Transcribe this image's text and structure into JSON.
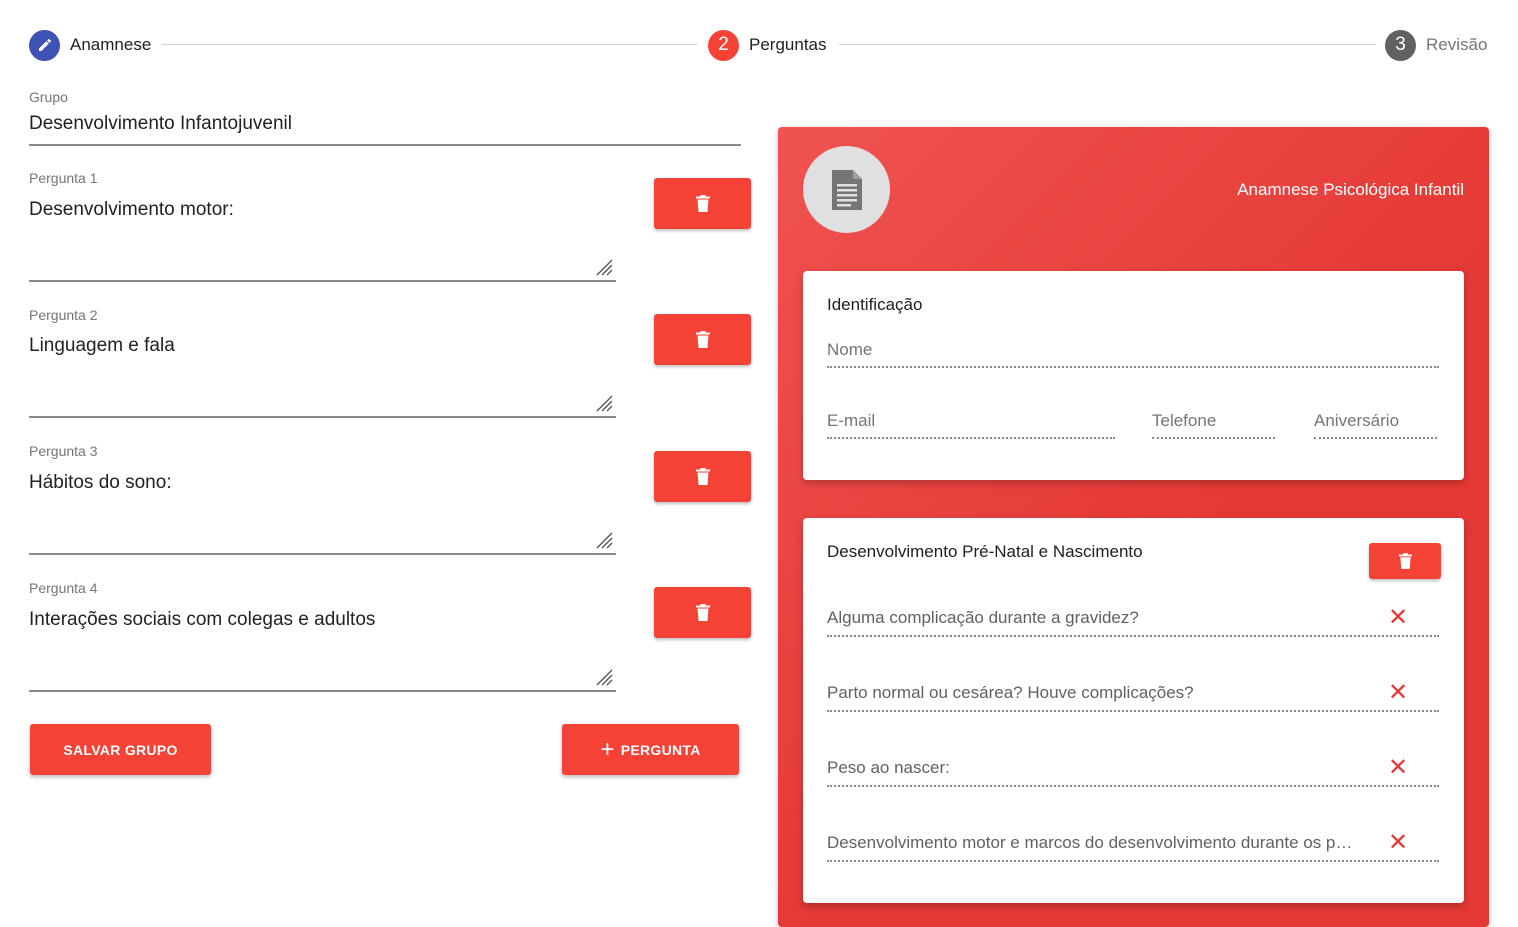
{
  "stepper": {
    "steps": [
      {
        "number": "",
        "label": "Anamnese"
      },
      {
        "number": "2",
        "label": "Perguntas"
      },
      {
        "number": "3",
        "label": "Revisão"
      }
    ]
  },
  "form": {
    "group_label": "Grupo",
    "group_value": "Desenvolvimento Infantojuvenil",
    "questions": [
      {
        "label": "Pergunta 1",
        "value": "Desenvolvimento motor:"
      },
      {
        "label": "Pergunta 2",
        "value": "Linguagem e fala"
      },
      {
        "label": "Pergunta 3",
        "value": "Hábitos do sono:"
      },
      {
        "label": "Pergunta 4",
        "value": "Interações sociais com colegas e adultos"
      }
    ],
    "save_label": "SALVAR GRUPO",
    "add_label": "PERGUNTA"
  },
  "preview": {
    "title": "Anamnese Psicológica Infantil",
    "identification": {
      "title": "Identificação",
      "fields": {
        "name": "Nome",
        "email": "E-mail",
        "phone": "Telefone",
        "birthday": "Aniversário"
      }
    },
    "group_card": {
      "title": "Desenvolvimento Pré-Natal e Nascimento",
      "questions": [
        "Alguma complicação durante a gravidez?",
        "Parto normal ou cesárea? Houve complicações?",
        "Peso ao nascer:",
        "Desenvolvimento motor e marcos do desenvolvimento durante os primeiros anos"
      ]
    }
  },
  "colors": {
    "primary_red": "#f44336",
    "step_indigo": "#3f51b5",
    "step_grey": "#616161"
  },
  "icons": {
    "step1": "pencil-icon",
    "delete": "trash-icon",
    "textarea_resize": "resize-handle-icon",
    "avatar": "document-icon",
    "remove_question": "close-icon",
    "add": "plus-icon"
  }
}
